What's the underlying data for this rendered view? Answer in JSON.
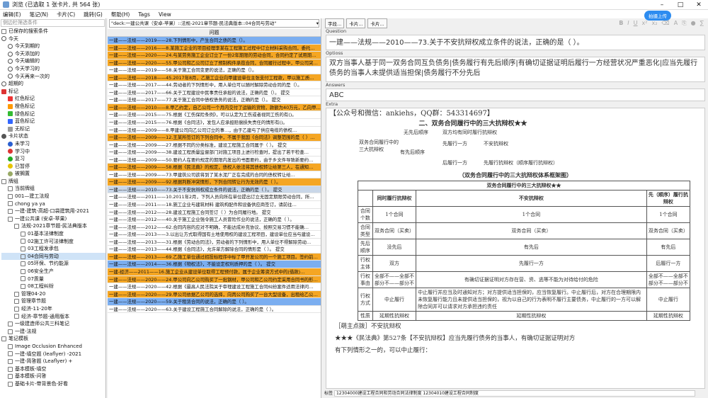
{
  "window": {
    "title": "浏览 (已选取 1 张卡片, 共 564 张)"
  },
  "menu": [
    "编辑(E)",
    "笔记(N)",
    "卡片(C)",
    "跳转(G)",
    "帮助(H)",
    "Tags",
    "View"
  ],
  "left": {
    "search_placeholder": "侧边栏筛选条件",
    "tree": [
      {
        "label": "已保存的搜索条件",
        "kind": "box",
        "indent": 0
      },
      {
        "label": "今天",
        "kind": "clock",
        "indent": 0
      },
      {
        "label": "今天到期的",
        "kind": "clock",
        "indent": 1
      },
      {
        "label": "今天添加的",
        "kind": "clock",
        "indent": 1
      },
      {
        "label": "今天编辑的",
        "kind": "clock",
        "indent": 1
      },
      {
        "label": "今天学习的",
        "kind": "clock",
        "indent": 1
      },
      {
        "label": "今天再来一次的",
        "kind": "clock",
        "indent": 1
      },
      {
        "label": "超期的",
        "kind": "clock",
        "indent": 0
      },
      {
        "label": "标记",
        "kind": "flag",
        "color": "#d33",
        "indent": 0
      },
      {
        "label": "红色标记",
        "kind": "flag",
        "color": "#e33",
        "indent": 1
      },
      {
        "label": "橙色标记",
        "kind": "flag",
        "color": "#f90",
        "indent": 1
      },
      {
        "label": "绿色标记",
        "kind": "flag",
        "color": "#3b3",
        "indent": 1
      },
      {
        "label": "蓝色标记",
        "kind": "flag",
        "color": "#36f",
        "indent": 1
      },
      {
        "label": "无标记",
        "kind": "flag",
        "color": "#999",
        "indent": 1
      },
      {
        "label": "卡片状态",
        "kind": "dot",
        "color": "#555",
        "indent": 0
      },
      {
        "label": "未学习",
        "kind": "dot",
        "color": "#2a5fd0",
        "indent": 1
      },
      {
        "label": "学习中",
        "kind": "dot",
        "color": "#d33",
        "indent": 1
      },
      {
        "label": "复习",
        "kind": "dot",
        "color": "#2a2",
        "indent": 1
      },
      {
        "label": "已暂停",
        "kind": "dot",
        "color": "#e6c300",
        "indent": 1
      },
      {
        "label": "被搁置",
        "kind": "dot",
        "color": "#9a6",
        "indent": 1
      },
      {
        "label": "牌组",
        "kind": "box",
        "indent": 0
      },
      {
        "label": "当前牌组",
        "kind": "box",
        "indent": 1
      },
      {
        "label": "001—建工法规",
        "kind": "box",
        "indent": 1
      },
      {
        "label": "chong ya ya",
        "kind": "box",
        "indent": 1
      },
      {
        "label": "一建-建筑-高超-口袋建筑用-2021",
        "kind": "box",
        "indent": 1
      },
      {
        "label": "一建公共课 (安卓-苹果)",
        "kind": "box",
        "indent": 1
      },
      {
        "label": "法规-2021章节题-民法典版本",
        "kind": "box",
        "indent": 2
      },
      {
        "label": "01基本法律制度",
        "kind": "box",
        "indent": 3
      },
      {
        "label": "02施工许可法律制度",
        "kind": "box",
        "indent": 3
      },
      {
        "label": "03工程发承包",
        "kind": "box",
        "indent": 3
      },
      {
        "label": "04合同与劳动",
        "kind": "box",
        "indent": 3,
        "selected": true
      },
      {
        "label": "05环保、节约能源",
        "kind": "box",
        "indent": 3
      },
      {
        "label": "06安全生产",
        "kind": "box",
        "indent": 3
      },
      {
        "label": "07质量",
        "kind": "box",
        "indent": 3
      },
      {
        "label": "08工程纠纷",
        "kind": "box",
        "indent": 3
      },
      {
        "label": "管理04-20",
        "kind": "box",
        "indent": 2
      },
      {
        "label": "管理章节题",
        "kind": "box",
        "indent": 2
      },
      {
        "label": "经济-11-20年",
        "kind": "box",
        "indent": 2
      },
      {
        "label": "经济-章节题-通用版本",
        "kind": "box",
        "indent": 2
      },
      {
        "label": "一级建造师公共三科笔记",
        "kind": "box",
        "indent": 1
      },
      {
        "label": "一建-法规",
        "kind": "box",
        "indent": 1
      },
      {
        "label": "笔记模板",
        "kind": "box",
        "indent": 0
      },
      {
        "label": "Image Occlusion Enhanced",
        "kind": "box",
        "indent": 1
      },
      {
        "label": "一建-填空题 (leaflyer) -2021",
        "kind": "box",
        "indent": 1
      },
      {
        "label": "一建-简答题 (Leaflyer) +",
        "kind": "box",
        "indent": 1
      },
      {
        "label": "基本模板-填空",
        "kind": "box",
        "indent": 1
      },
      {
        "label": "基本模板-问答",
        "kind": "box",
        "indent": 1
      },
      {
        "label": "基础卡片-带背景色-好看",
        "kind": "box",
        "indent": 1
      }
    ]
  },
  "middle": {
    "search_value": "\"deck:一建公共课（安卓-苹果）::法规-2021章节题-民法典版本::04合同与劳动\"",
    "column": "问题",
    "rows": [
      {
        "text": "一建——法规——2019——28.下列情形中，产生合同之债的是（）。",
        "c": "b"
      },
      {
        "text": "一建——法规——2016——8.某施工企业的项目经理李某在工程施工过程中订立材料采购合同，委托…",
        "c": "o"
      },
      {
        "text": "一建——法规——2020——24.与某劳务施工企业订立了一份2年期限的劳动合同，合同约定了试用期…",
        "c": "o"
      },
      {
        "text": "一建——法规——2020——55.甲公司和乙公司订立了预制构件承揽合同，合同履行过程中，甲公司突…",
        "c": "o"
      },
      {
        "text": "一建——法规——2019——58.关于施工合同变更的说法，正确的是（）。",
        "c": "w"
      },
      {
        "text": "一建——法规——2018——45.2017年8月，乙施工企业向甲建设单位主张支付工程款，甲以施工质…",
        "c": "o"
      },
      {
        "text": "一建——法规——2017——44.劳动者的下列情形中，用人单位可以随时解除劳动合同的是（）。",
        "c": "w"
      },
      {
        "text": "一建——法规——2017——66.关于工程建设中民事责任承担的说法，正确的是（）。        提交",
        "c": "w"
      },
      {
        "text": "一建——法规——2017——77.关于施工合同中债权债务的说法，正确的是（）。     提交",
        "c": "w"
      },
      {
        "text": "一建——法规——2010——8.甲乙约定，自乙公司一个月内交付了运输的货物，款额为40万元，乙向甲…",
        "c": "o"
      },
      {
        "text": "一建——法规——2015——75.根据《工伤保险条例》，可以认定为工伤或者视同工伤的有()。",
        "c": "w"
      },
      {
        "text": "一建——法规——2015——76.根据《合同法》，发包人应承担赔偿损失责任的情形有()。",
        "c": "w"
      },
      {
        "text": "一建——法规——2009——8.甲建公司向乙公司订立的事…，由于乙建与了供应电缆的债权…",
        "c": "w"
      },
      {
        "text": "一建——法规——2009——12.王某所签订的下列合同中，不属于我国《合同法》调整范围的是（ ）…",
        "c": "o"
      },
      {
        "text": "一建——法规——2009——27.根据不同的分类标准，建设工程施工合同属于（ ）。      提交",
        "c": "w"
      },
      {
        "text": "一建——法规——2009——38.建设工程质量监督部门对施工项目上进行检查时，提出了若干检查…",
        "c": "w"
      },
      {
        "text": "一建——法规——2009——50.要约人在要约规定的期限内发出的书面要约，由于乡文件导致新要约…",
        "c": "w"
      },
      {
        "text": "一建——法规——2009——58.根据《民法典》的规定，债权人依法将其债权转让给第三人，在通知…",
        "c": "o"
      },
      {
        "text": "一建——法规——2009——73.甲建筑公司欲将到了某水泥厂正在完成的合同的债权转让给…",
        "c": "w"
      },
      {
        "text": "一建——法规——2009——92.根据判断冲突情形，下列合同转让行为无效的是（ ）。",
        "c": "o"
      },
      {
        "text": "一建——法规——2010——73.关于不安抗辩权成立条件的说法，正确的是（ ）。     提交",
        "c": "s"
      },
      {
        "text": "一建——法规——2011——10.2011年2月，下列人员向所在单位提出订立无固定期限劳动合同，所…",
        "c": "w"
      },
      {
        "text": "一建——法规——2011——18.施工企业与建筑材料 建筑构配件和设备供应商签订，请前往…",
        "c": "w"
      },
      {
        "text": "一建——法规——2012——28.建设工程施工合同签订（ ）为合同履行地。      提交",
        "c": "w"
      },
      {
        "text": "一建——法规——2012——40.关于施工企业强令施工人员冒险作业的说法，正确的是（ ）。",
        "c": "w"
      },
      {
        "text": "一建——法规——2012——62.合同内容的应对不明确，不能达成补充协议、按照交易习惯不能确…",
        "c": "w"
      },
      {
        "text": "一建——法规——2013——3.以出让方式取得国有土地使用权的建设工程项目，建设单位应当与建设…",
        "c": "w"
      },
      {
        "text": "一建——法规——2013——31.根据《劳动合同法》，劳动者的下列情形中，用人单位不得解除劳动…",
        "c": "w"
      },
      {
        "text": "一建——法规——2013——44.根据《合同法》，允许单方解除合同的情形是（ ）。   提交",
        "c": "w"
      },
      {
        "text": "一建——法规——2013——69.乙施工单位通过招投标程序中标了甲开发公司的一个施工项目。签约前…",
        "c": "o"
      },
      {
        "text": "一建——法规——2014——36.根据《物权法》，不能设定权利质押的是（ ）。      提交",
        "c": "b"
      },
      {
        "text": "一建-经济——2011——16.施工企业从建设单位取得工程预付款，属于企业筹资方式中的(借款)…",
        "c": "o"
      },
      {
        "text": "一建——法规——2020——24.甲公司向乙公司购买了一批钢材，甲公司和乙公司约定采用合同书的形…",
        "c": "o"
      },
      {
        "text": "一建——法规——2020——42.根据《最高人民法院关于审理建设工程施工合同纠纷案件适用法律问…",
        "c": "w"
      },
      {
        "text": "一建——法规——2020——29.甲公司依据乙公司的选择，向丙公司购买了一台大型设备，出租给乙公…",
        "c": "o"
      },
      {
        "text": "一建——法规——2020——59.关于租赁合同的说法，正确的是（ ）。",
        "c": "b"
      },
      {
        "text": "一建——法规——2020——63.关于建设工程施工合同解除的说法，正确的是（ ）。",
        "c": "w"
      }
    ]
  },
  "right": {
    "buttons": [
      "字段...",
      "卡片...",
      "卡片..."
    ],
    "upload_label": "拍摄上传",
    "fields": {
      "question_label": "Question",
      "question": "一建——法规——2010——73.关于不安抗辩权成立条件的说法，正确的是（ ）。",
      "options_label": "Optioss",
      "options": "双方当事人基于同一双务合同互负债务|债务履行有先后顺序|有确切证据证明后履行一方经营状况严重恶化|应当先履行债务的当事人未提供适当担保|债务履行不分先后",
      "answers_label": "Answers",
      "answers": "ABC",
      "extra_label": "Extra"
    },
    "extra": {
      "wechat": "【公众号和微信：ankiehs，QQ群：543314697】",
      "heading": "二、双务合同履行中的三大抗辩权★★",
      "diagram": {
        "root": "双务合同履行中的三大抗辩权",
        "no_order": "无先后顺序",
        "no_order_right": "双方均有同时履行抗辩权",
        "has_order": "有先后顺序",
        "first": "先履行一方",
        "first_right": "不安抗辩权",
        "later": "后履行一方",
        "later_right": "先履行抗辩权（顺序履行抗辩权）"
      },
      "caption": "（双务合同履行中的三大抗辩权体系框架图）",
      "table_title": "双务合同履行中的三大抗辩权★★",
      "table_header": [
        "",
        "同时履行抗辩权",
        "不安抗辩权",
        "先（顺序）履行抗辩权"
      ],
      "table_rows": [
        [
          "合同个数",
          "1个合同",
          "1个合同",
          "1个合同"
        ],
        [
          "合同类型",
          "双务合同（买卖）",
          "双务合同（买卖）",
          "双务合同（买卖）"
        ],
        [
          "先后顺序",
          "没先后",
          "有先后",
          "有先后"
        ],
        [
          "行权主体",
          "双方",
          "先履行一方",
          "后履行一方"
        ],
        [
          "行权事由",
          "全部不——全部不 部分不——部分不",
          "有确切证据证明对方存在营、资、逃等不能为对待给付的危险",
          "全部不——全部不 部分不——部分不"
        ],
        [
          "行权方式",
          "中止履行",
          "中止履行并应当及时通知对方；对方提供适当担保的，应当恢复履行。中止履行后，对方在合理期限内未恢复履行能力且未提供适当担保的，视为以自己的行为表明不履行主要债务，中止履行的一方可以解除合同并可以请求对方承担违约责任",
          "中止履行"
        ],
        [
          "性质",
          "延期性抗辩权",
          "延期性抗辩权",
          "延期性抗辩权"
        ]
      ],
      "note1": "［萌主点拨］不安抗辩权",
      "note2": "★★★《民法典》第527条【不安抗辩权】应当先履行债务的当事人，有确切证据证明对方",
      "note3": "有下列情形之一的，可以中止履行："
    },
    "tags_label": "标签",
    "tags_value": "12304000建设工程合同和劳动合同法律制度 12304010建设工程合同制度"
  }
}
